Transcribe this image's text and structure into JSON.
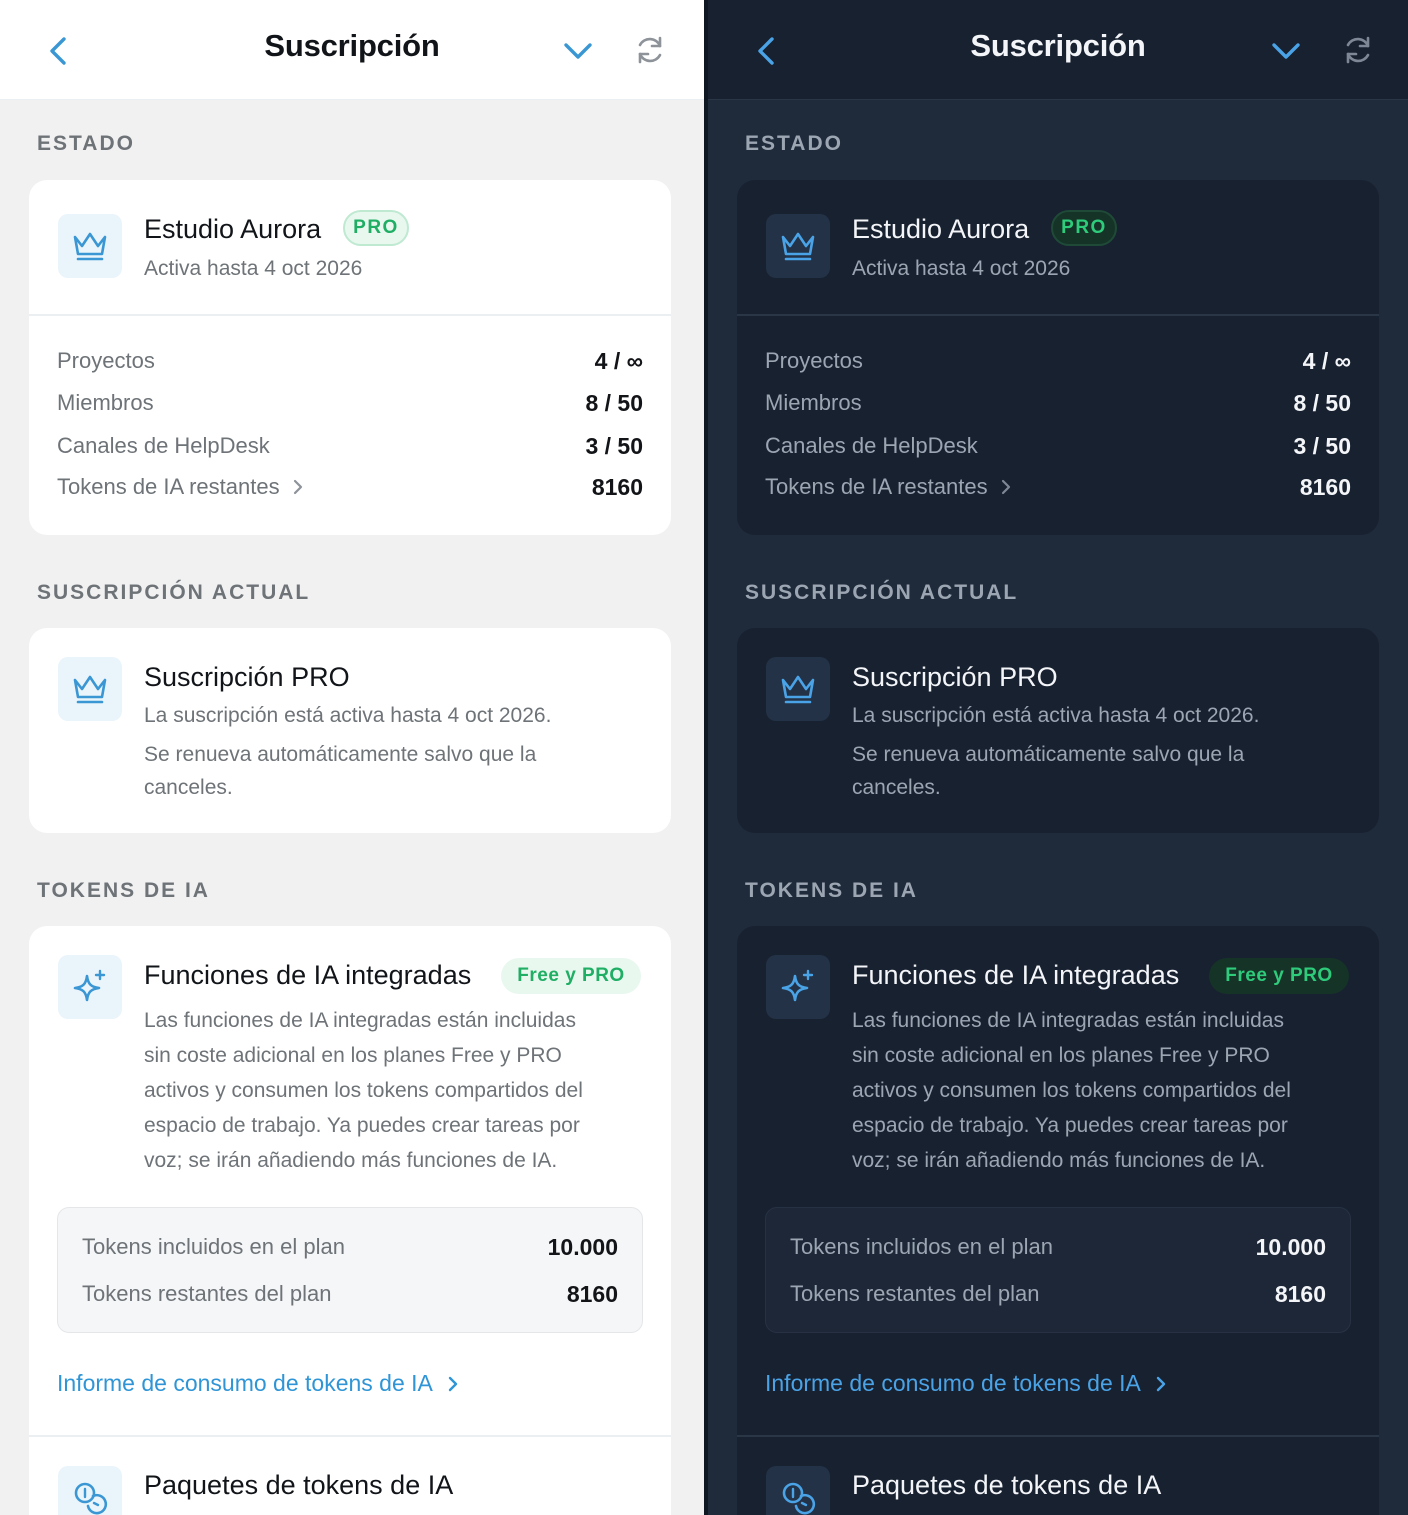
{
  "header": {
    "title": "Suscripción"
  },
  "estado": {
    "section_label": "ESTADO",
    "workspace_name": "Estudio Aurora",
    "plan_badge": "PRO",
    "active_until": "Activa hasta 4 oct 2026",
    "rows": [
      {
        "label": "Proyectos",
        "value": "4 / ∞"
      },
      {
        "label": "Miembros",
        "value": "8 / 50"
      },
      {
        "label": "Canales de HelpDesk",
        "value": "3 / 50"
      },
      {
        "label": "Tokens de IA restantes",
        "value": "8160"
      }
    ]
  },
  "suscripcion": {
    "section_label": "SUSCRIPCIÓN ACTUAL",
    "title": "Suscripción PRO",
    "line1": "La suscripción está activa hasta 4 oct 2026.",
    "line2": "Se renueva automáticamente salvo que la",
    "line3": "canceles."
  },
  "tokens": {
    "section_label": "TOKENS DE IA",
    "title": "Funciones de IA integradas",
    "badge": "Free y PRO",
    "desc_lines": [
      "Las funciones de IA integradas están incluidas",
      "sin coste adicional en los planes Free y PRO",
      "activos y consumen los tokens compartidos del",
      "espacio de trabajo. Ya puedes crear tareas por",
      "voz; se irán añadiendo más funciones de IA."
    ],
    "included_label": "Tokens incluidos en el plan",
    "included_value": "10.000",
    "remaining_label": "Tokens restantes del plan",
    "remaining_value": "8160",
    "report_link": "Informe de consumo de tokens de IA",
    "packages_title": "Paquetes de tokens de IA"
  }
}
